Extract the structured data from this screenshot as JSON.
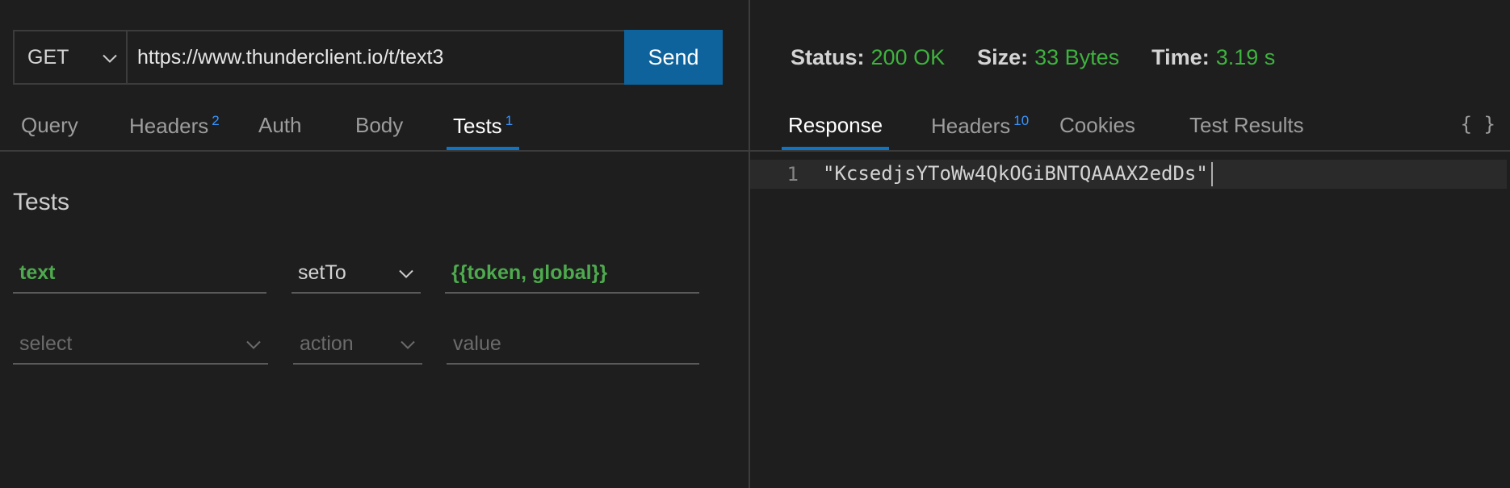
{
  "request": {
    "method": "GET",
    "url": "https://www.thunderclient.io/t/text3",
    "send_label": "Send"
  },
  "request_tabs": [
    {
      "label": "Query",
      "badge": ""
    },
    {
      "label": "Headers",
      "badge": "2"
    },
    {
      "label": "Auth",
      "badge": ""
    },
    {
      "label": "Body",
      "badge": ""
    },
    {
      "label": "Tests",
      "badge": "1"
    }
  ],
  "tests": {
    "title": "Tests",
    "rows": [
      {
        "select": "text",
        "action": "setTo",
        "value": "{{token, global}}"
      },
      {
        "select_placeholder": "select",
        "action_placeholder": "action",
        "value_placeholder": "value"
      }
    ]
  },
  "response": {
    "status_label": "Status:",
    "status_value": "200 OK",
    "size_label": "Size:",
    "size_value": "33 Bytes",
    "time_label": "Time:",
    "time_value": "3.19 s",
    "status_color": "#3eb23e"
  },
  "response_tabs": [
    {
      "label": "Response",
      "badge": ""
    },
    {
      "label": "Headers",
      "badge": "10"
    },
    {
      "label": "Cookies",
      "badge": ""
    },
    {
      "label": "Test Results",
      "badge": ""
    }
  ],
  "format_toggle": "{ }",
  "body": {
    "line_number": "1",
    "content": "\"KcsedjsYToWw4QkOGiBNTQAAAX2edDs\""
  },
  "icons": {
    "dropdown": "chevron-down-icon"
  },
  "colors": {
    "accent": "#0e639c",
    "success": "#3eb23e",
    "badge": "#3794ff"
  }
}
